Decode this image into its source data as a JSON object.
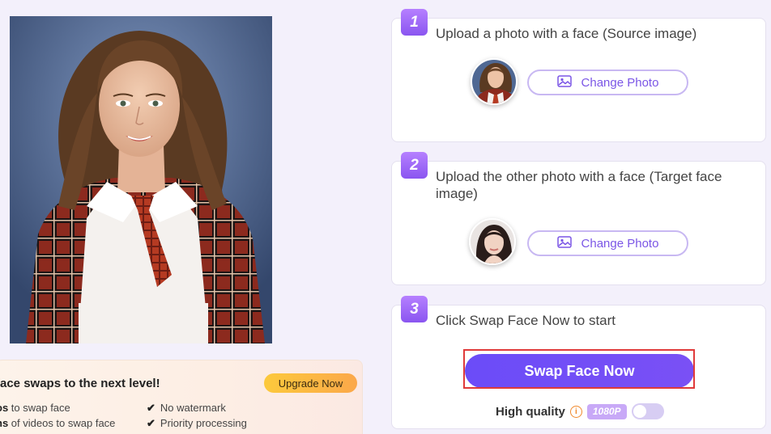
{
  "steps": [
    {
      "number": "1",
      "text": "Upload a photo with a face (Source image)",
      "button_label": "Change Photo"
    },
    {
      "number": "2",
      "text": "Upload the other photo with a face (Target face image)",
      "button_label": "Change Photo"
    },
    {
      "number": "3",
      "text": "Click Swap Face Now to start",
      "button_label": "Swap Face Now"
    }
  ],
  "quality": {
    "label": "High quality",
    "info_glyph": "i",
    "resolution": "1080P",
    "toggle_on": false
  },
  "promo": {
    "title": "face swaps to the next level!",
    "upgrade_label": "Upgrade Now",
    "features": [
      {
        "bold": "os",
        "rest": " to swap face"
      },
      {
        "bold": "ns",
        "rest": " of videos to swap face"
      },
      {
        "text": "No watermark"
      },
      {
        "text": "Priority processing"
      }
    ]
  },
  "colors": {
    "accent": "#6b4cf8",
    "badge": "#8a55f0",
    "highlight_outline": "#e03a3a",
    "upgrade": "#fcc93c"
  },
  "icons": {
    "change_photo": "image-icon",
    "check": "check-icon",
    "info": "info-icon"
  }
}
